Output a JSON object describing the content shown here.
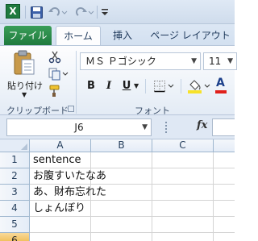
{
  "quick_access": {
    "app_icon": "excel-icon",
    "save_icon": "save-icon",
    "undo_icon": "undo-icon",
    "redo_icon": "redo-icon",
    "customize_icon": "customize-qat-icon"
  },
  "ribbon_tabs": {
    "file": "ファイル",
    "home": "ホーム",
    "insert": "挿入",
    "page_layout": "ページ レイアウト"
  },
  "clipboard_group": {
    "paste_label": "貼り付け",
    "group_label": "クリップボード"
  },
  "font_group": {
    "font_name": "ＭＳ Ｐゴシック",
    "font_size": "11",
    "bold": "B",
    "italic": "I",
    "underline": "U",
    "group_label": "フォント",
    "font_color": "#e0201b",
    "fill_color": "#f7e22a"
  },
  "formula_bar": {
    "name_box": "J6",
    "fx_label": "fx"
  },
  "sheet": {
    "columns": [
      "A",
      "B",
      "C"
    ],
    "rows": [
      "1",
      "2",
      "3",
      "4",
      "5",
      "6"
    ],
    "selected_row": "6",
    "cells": {
      "A1": "sentence",
      "A2": "お腹すいたなあ",
      "A3": "あ、財布忘れた",
      "A4": "しょんぼり"
    }
  }
}
